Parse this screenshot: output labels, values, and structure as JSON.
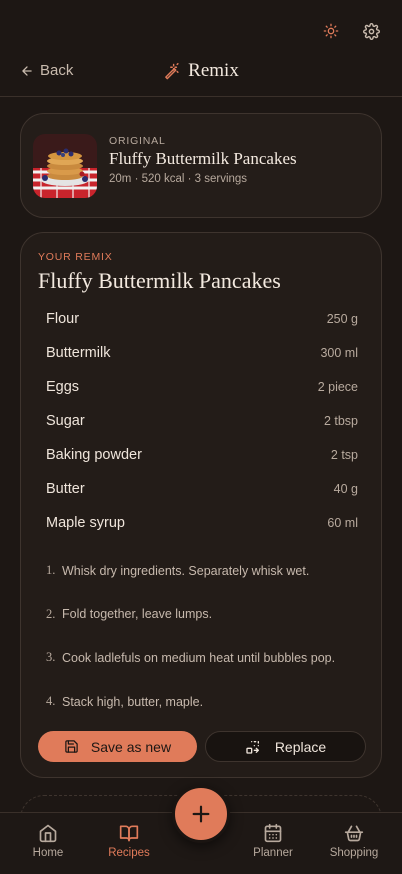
{
  "header": {
    "back_label": "Back",
    "title": "Remix"
  },
  "original": {
    "overline": "ORIGINAL",
    "name": "Fluffy Buttermilk Pancakes",
    "meta": "20m · 520 kcal · 3 servings"
  },
  "remix": {
    "overline": "YOUR REMIX",
    "name": "Fluffy Buttermilk Pancakes",
    "ingredients": [
      {
        "name": "Flour",
        "qty": "250 g"
      },
      {
        "name": "Buttermilk",
        "qty": "300 ml"
      },
      {
        "name": "Eggs",
        "qty": "2 piece"
      },
      {
        "name": "Sugar",
        "qty": "2 tbsp"
      },
      {
        "name": "Baking powder",
        "qty": "2 tsp"
      },
      {
        "name": "Butter",
        "qty": "40 g"
      },
      {
        "name": "Maple syrup",
        "qty": "60 ml"
      }
    ],
    "steps": [
      {
        "num": "1.",
        "text": "Whisk dry ingredients. Separately whisk wet."
      },
      {
        "num": "2.",
        "text": "Fold together, leave lumps."
      },
      {
        "num": "3.",
        "text": "Cook ladlefuls on medium heat until bubbles pop."
      },
      {
        "num": "4.",
        "text": "Stack high, butter, maple."
      }
    ],
    "save_label": "Save as new",
    "replace_label": "Replace"
  },
  "nav": {
    "home": "Home",
    "recipes": "Recipes",
    "planner": "Planner",
    "shopping": "Shopping",
    "active": "recipes"
  },
  "icons": {
    "theme": "sun-icon",
    "settings": "gear-icon",
    "back": "arrow-left-icon",
    "title": "magic-wand-icon",
    "save": "save-icon",
    "replace": "replace-icon",
    "fab": "plus-icon"
  },
  "colors": {
    "accent": "#e07b5a",
    "background": "#1d1714",
    "card": "#231c18"
  }
}
